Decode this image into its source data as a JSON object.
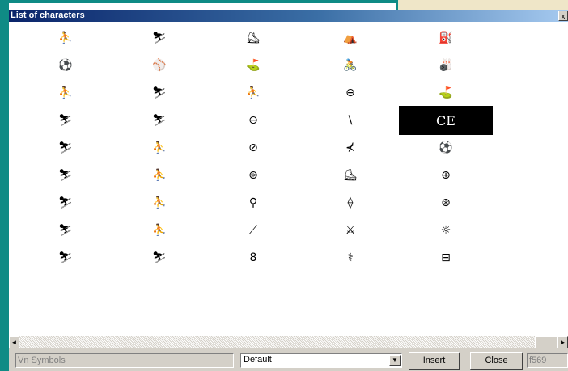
{
  "dialog": {
    "title": "List of characters",
    "close_glyph": "x"
  },
  "characters": [
    "⛹",
    "⛷",
    "⛸",
    "⛺",
    "⛽",
    "⚽",
    "⚾",
    "⛳",
    "🚴",
    "🎳",
    "⛹",
    "⛷",
    "⛹",
    "⊖",
    "⛳",
    "⛷",
    "⛷",
    "⊖",
    "\\",
    "CE",
    "⛷",
    "⛹",
    "⊘",
    "⊀",
    "⚽",
    "⛷",
    "⛹",
    "⊛",
    "⛸",
    "⊕",
    "⛷",
    "⛹",
    "⚲",
    "⟠",
    "⊛",
    "⛷",
    "⛹",
    "⟋",
    "⚔",
    "☼",
    "⛷",
    "⛷",
    "8",
    "⚕",
    "⊟"
  ],
  "selected_index": 19,
  "scrollbar": {
    "left_arrow": "◄",
    "right_arrow": "►"
  },
  "footer": {
    "font_name": "Vn Symbols",
    "style_value": "Default",
    "dropdown_arrow": "▼",
    "insert_label": "Insert",
    "close_label": "Close",
    "code_value": "f569"
  },
  "colors": {
    "title_start": "#0a246a",
    "teal_frame": "#0f8b85",
    "face": "#d4d0c8"
  }
}
